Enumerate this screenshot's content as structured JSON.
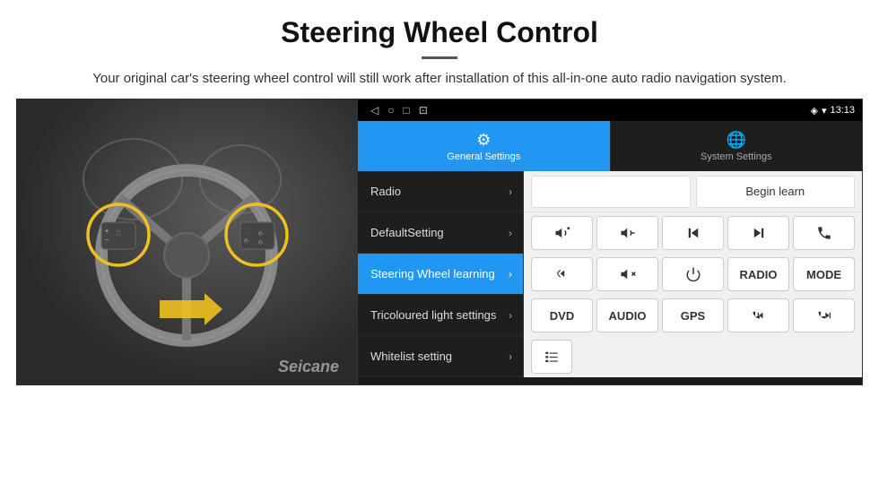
{
  "header": {
    "title": "Steering Wheel Control",
    "description": "Your original car's steering wheel control will still work after installation of this all-in-one auto radio navigation system."
  },
  "status_bar": {
    "time": "13:13",
    "nav_back": "◁",
    "nav_home": "○",
    "nav_recent": "□",
    "nav_extra": "⊡"
  },
  "tabs": [
    {
      "label": "General Settings",
      "icon": "⚙",
      "active": true
    },
    {
      "label": "System Settings",
      "icon": "🌐",
      "active": false
    }
  ],
  "menu_items": [
    {
      "label": "Radio",
      "active": false
    },
    {
      "label": "DefaultSetting",
      "active": false
    },
    {
      "label": "Steering Wheel learning",
      "active": true
    },
    {
      "label": "Tricoloured light settings",
      "active": false
    },
    {
      "label": "Whitelist setting",
      "active": false
    }
  ],
  "control": {
    "begin_learn_label": "Begin learn",
    "buttons_row1": [
      {
        "label": "🔊+",
        "name": "vol-up"
      },
      {
        "label": "🔊−",
        "name": "vol-down"
      },
      {
        "label": "⏮",
        "name": "prev-track"
      },
      {
        "label": "⏭",
        "name": "next-track"
      },
      {
        "label": "📞",
        "name": "phone"
      }
    ],
    "buttons_row2": [
      {
        "label": "↩",
        "name": "back"
      },
      {
        "label": "🔇×",
        "name": "mute"
      },
      {
        "label": "⏻",
        "name": "power"
      },
      {
        "label": "RADIO",
        "name": "radio"
      },
      {
        "label": "MODE",
        "name": "mode"
      }
    ],
    "buttons_row3": [
      {
        "label": "DVD",
        "name": "dvd"
      },
      {
        "label": "AUDIO",
        "name": "audio"
      },
      {
        "label": "GPS",
        "name": "gps"
      },
      {
        "label": "📞⏮",
        "name": "phone-prev"
      },
      {
        "label": "📞⏭",
        "name": "phone-next"
      }
    ],
    "buttons_row4": [
      {
        "label": "≡",
        "name": "menu-icon-btn"
      }
    ]
  },
  "watermark": "Seicane"
}
